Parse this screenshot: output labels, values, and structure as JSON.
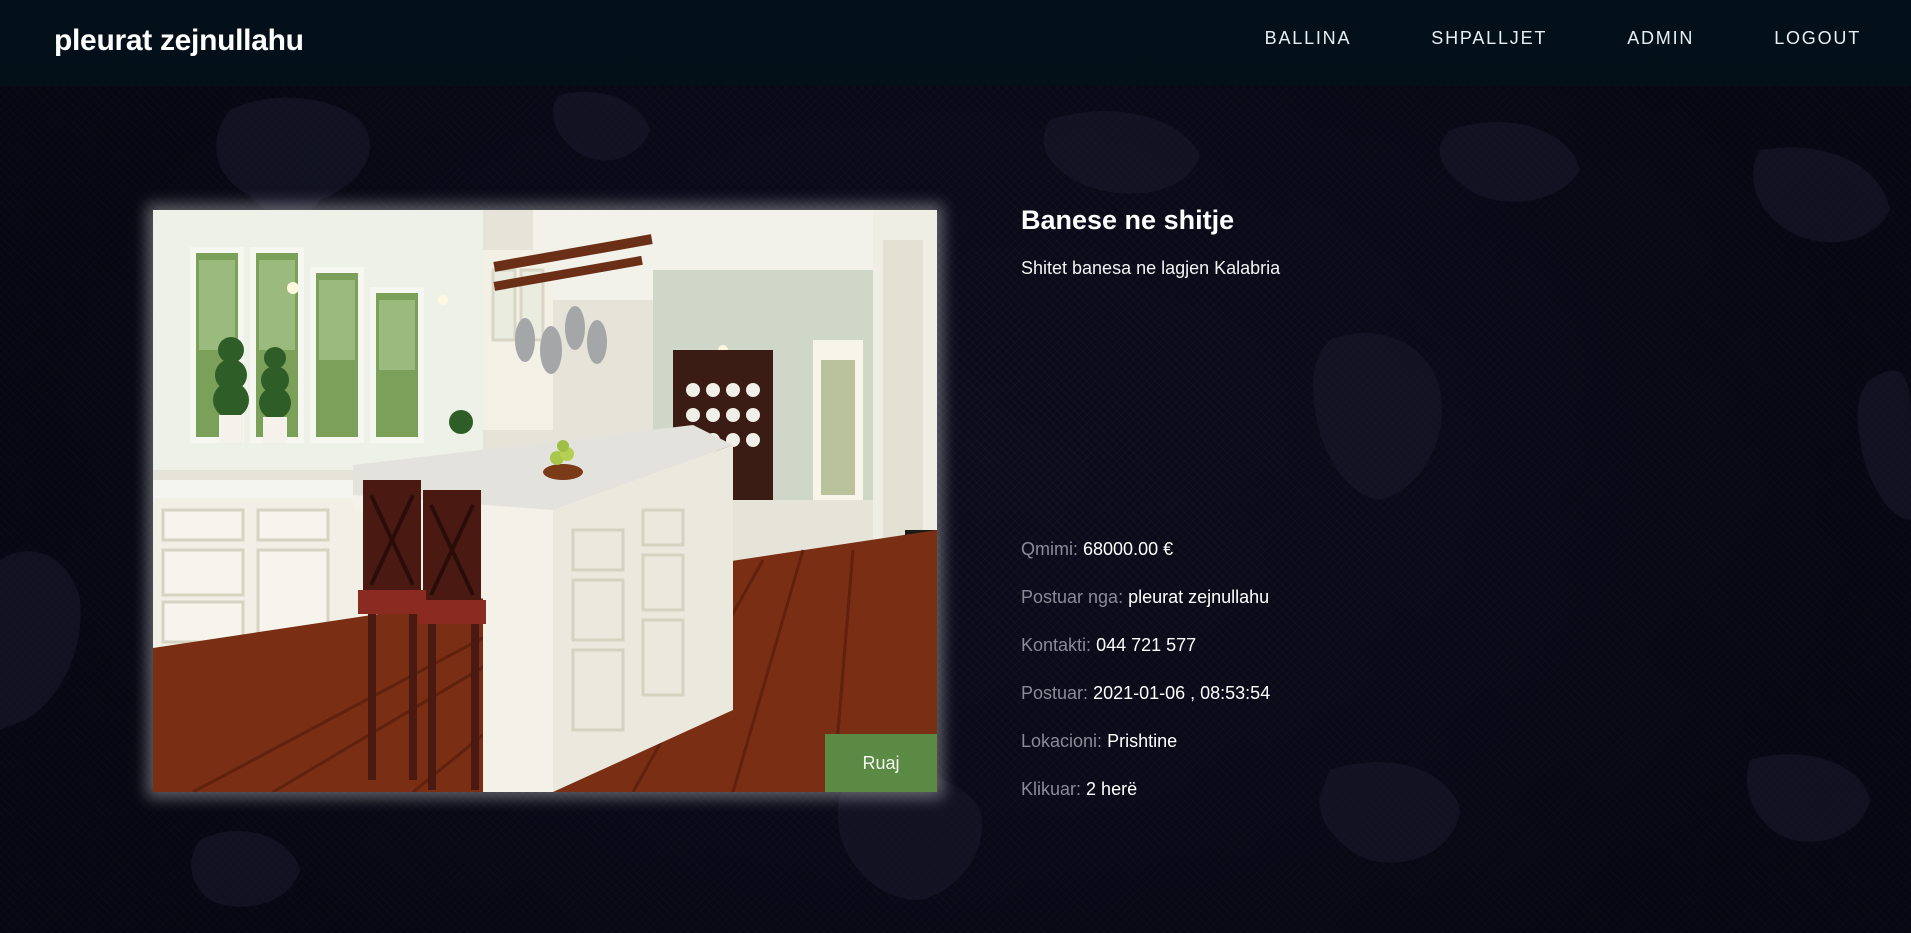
{
  "header": {
    "brand": "pleurat zejnullahu",
    "nav": [
      {
        "label": "BALLINA"
      },
      {
        "label": "SHPALLJET"
      },
      {
        "label": "ADMIN"
      },
      {
        "label": "LOGOUT"
      }
    ]
  },
  "listing": {
    "title": "Banese ne shitje",
    "description": "Shitet banesa ne lagjen Kalabria",
    "save_label": "Ruaj",
    "details": [
      {
        "key": "Qmimi:",
        "value": "68000.00 €"
      },
      {
        "key": "Postuar nga:",
        "value": "pleurat zejnullahu"
      },
      {
        "key": "Kontakti:",
        "value": "044 721 577"
      },
      {
        "key": "Postuar:",
        "value": "2021-01-06 , 08:53:54"
      },
      {
        "key": "Lokacioni:",
        "value": "Prishtine"
      },
      {
        "key": "Klikuar:",
        "value": "2 herë"
      }
    ]
  },
  "colors": {
    "accent_button": "#5a8a43",
    "navbar": "#03101a",
    "background": "#0b0b1c"
  }
}
